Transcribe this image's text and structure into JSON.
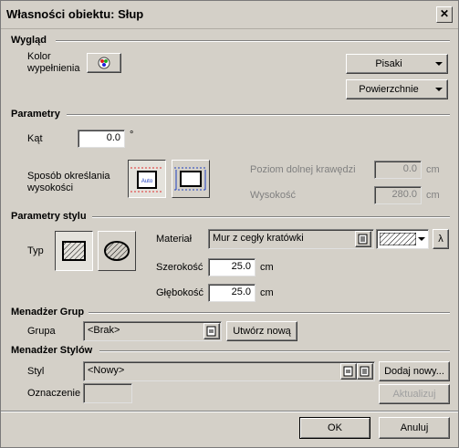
{
  "window": {
    "title": "Własności obiektu: Słup",
    "close_glyph": "✕"
  },
  "appearance": {
    "section": "Wygląd",
    "fill_color_label": "Kolor wypełnienia",
    "pens_button": "Pisaki",
    "surfaces_button": "Powierzchnie"
  },
  "parameters": {
    "section": "Parametry",
    "angle_label": "Kąt",
    "angle_value": "0.0",
    "angle_unit": "°",
    "height_method_label": "Sposób określania wysokości",
    "auto_icon_text": "Auto",
    "bottom_edge_label": "Poziom dolnej krawędzi",
    "bottom_edge_value": "0.0",
    "bottom_edge_unit": "cm",
    "height_label": "Wysokość",
    "height_value": "280.0",
    "height_unit": "cm"
  },
  "style_parameters": {
    "section": "Parametry stylu",
    "type_label": "Typ",
    "material_label": "Materiał",
    "material_value": "Mur z cegły kratówki",
    "lambda_button": "λ",
    "width_label": "Szerokość",
    "width_value": "25.0",
    "width_unit": "cm",
    "depth_label": "Głębokość",
    "depth_value": "25.0",
    "depth_unit": "cm"
  },
  "group_manager": {
    "section": "Menadżer Grup",
    "group_label": "Grupa",
    "group_value": "<Brak>",
    "create_button": "Utwórz nową"
  },
  "style_manager": {
    "section": "Menadżer Stylów",
    "style_label": "Styl",
    "style_value": "<Nowy>",
    "add_button": "Dodaj nowy...",
    "mark_label": "Oznaczenie",
    "mark_value": "",
    "update_button": "Aktualizuj"
  },
  "footer": {
    "ok_button": "OK",
    "cancel_button": "Anuluj"
  },
  "colors": {
    "dialog_bg": "#d4d0c8",
    "disabled_text": "#808080",
    "dashed_red": "#e03030"
  }
}
